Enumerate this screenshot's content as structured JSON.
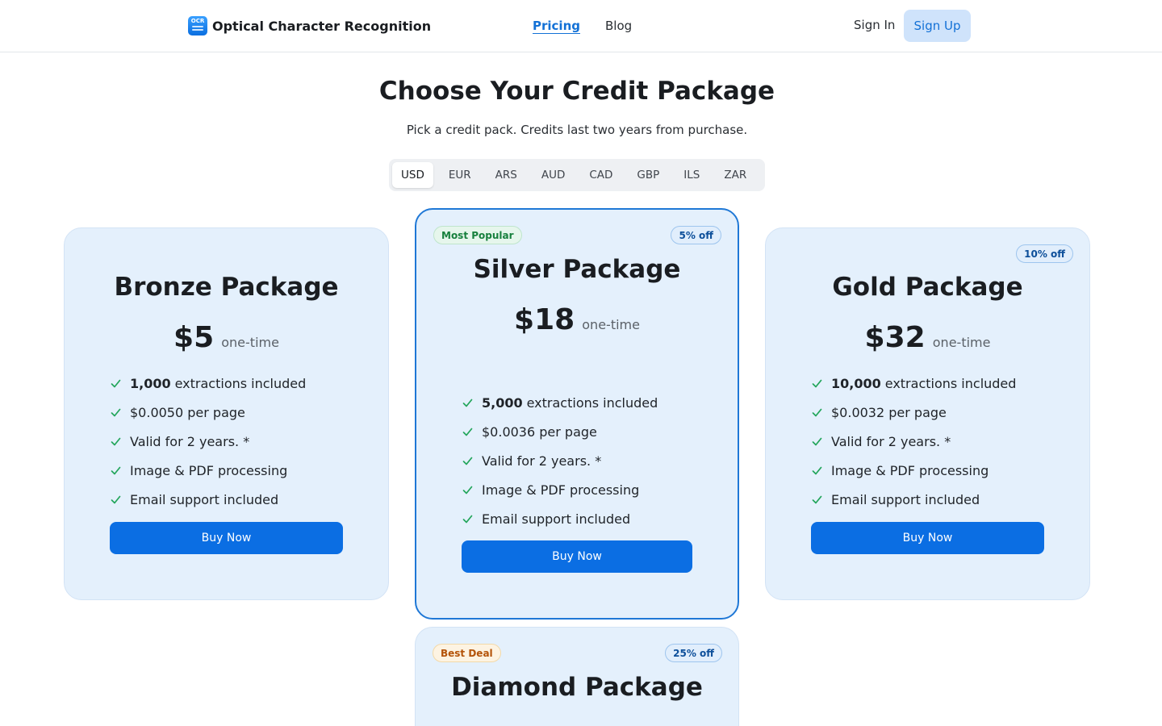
{
  "nav": {
    "brand": "Optical Character Recognition",
    "logo_text": "OCR",
    "links": [
      {
        "label": "Pricing",
        "active": true
      },
      {
        "label": "Blog",
        "active": false
      }
    ],
    "sign_in": "Sign In",
    "sign_up": "Sign Up"
  },
  "hero": {
    "title": "Choose Your Credit Package",
    "subtitle": "Pick a credit pack. Credits last two years from purchase."
  },
  "currencies": {
    "selected": "USD",
    "options": [
      "USD",
      "EUR",
      "ARS",
      "AUD",
      "CAD",
      "GBP",
      "ILS",
      "ZAR"
    ]
  },
  "packages": [
    {
      "name": "Bronze Package",
      "price": "$5",
      "price_unit": "one-time",
      "badge_left": "",
      "badge_right": "",
      "features": [
        {
          "strong": "1,000",
          "text": "extractions included"
        },
        {
          "strong": "",
          "text": "$0.0050 per page"
        },
        {
          "strong": "",
          "text": "Valid for 2 years. *"
        },
        {
          "strong": "",
          "text": "Image & PDF processing"
        },
        {
          "strong": "",
          "text": "Email support included"
        }
      ],
      "button": "Buy Now"
    },
    {
      "name": "Silver Package",
      "price": "$18",
      "price_unit": "one-time",
      "badge_left": "Most Popular",
      "badge_right": "5% off",
      "features": [
        {
          "strong": "5,000",
          "text": "extractions included"
        },
        {
          "strong": "",
          "text": "$0.0036 per page"
        },
        {
          "strong": "",
          "text": "Valid for 2 years. *"
        },
        {
          "strong": "",
          "text": "Image & PDF processing"
        },
        {
          "strong": "",
          "text": "Email support included"
        }
      ],
      "button": "Buy Now"
    },
    {
      "name": "Gold Package",
      "price": "$32",
      "price_unit": "one-time",
      "badge_left": "",
      "badge_right": "10% off",
      "features": [
        {
          "strong": "10,000",
          "text": "extractions included"
        },
        {
          "strong": "",
          "text": "$0.0032 per page"
        },
        {
          "strong": "",
          "text": "Valid for 2 years. *"
        },
        {
          "strong": "",
          "text": "Image & PDF processing"
        },
        {
          "strong": "",
          "text": "Email support included"
        }
      ],
      "button": "Buy Now"
    },
    {
      "name": "Diamond Package",
      "badge_left": "Best Deal",
      "badge_right": "25% off"
    }
  ],
  "colors": {
    "accent": "#0b6ee3",
    "card_bg": "#e4f0fc",
    "check": "#22a55a"
  }
}
